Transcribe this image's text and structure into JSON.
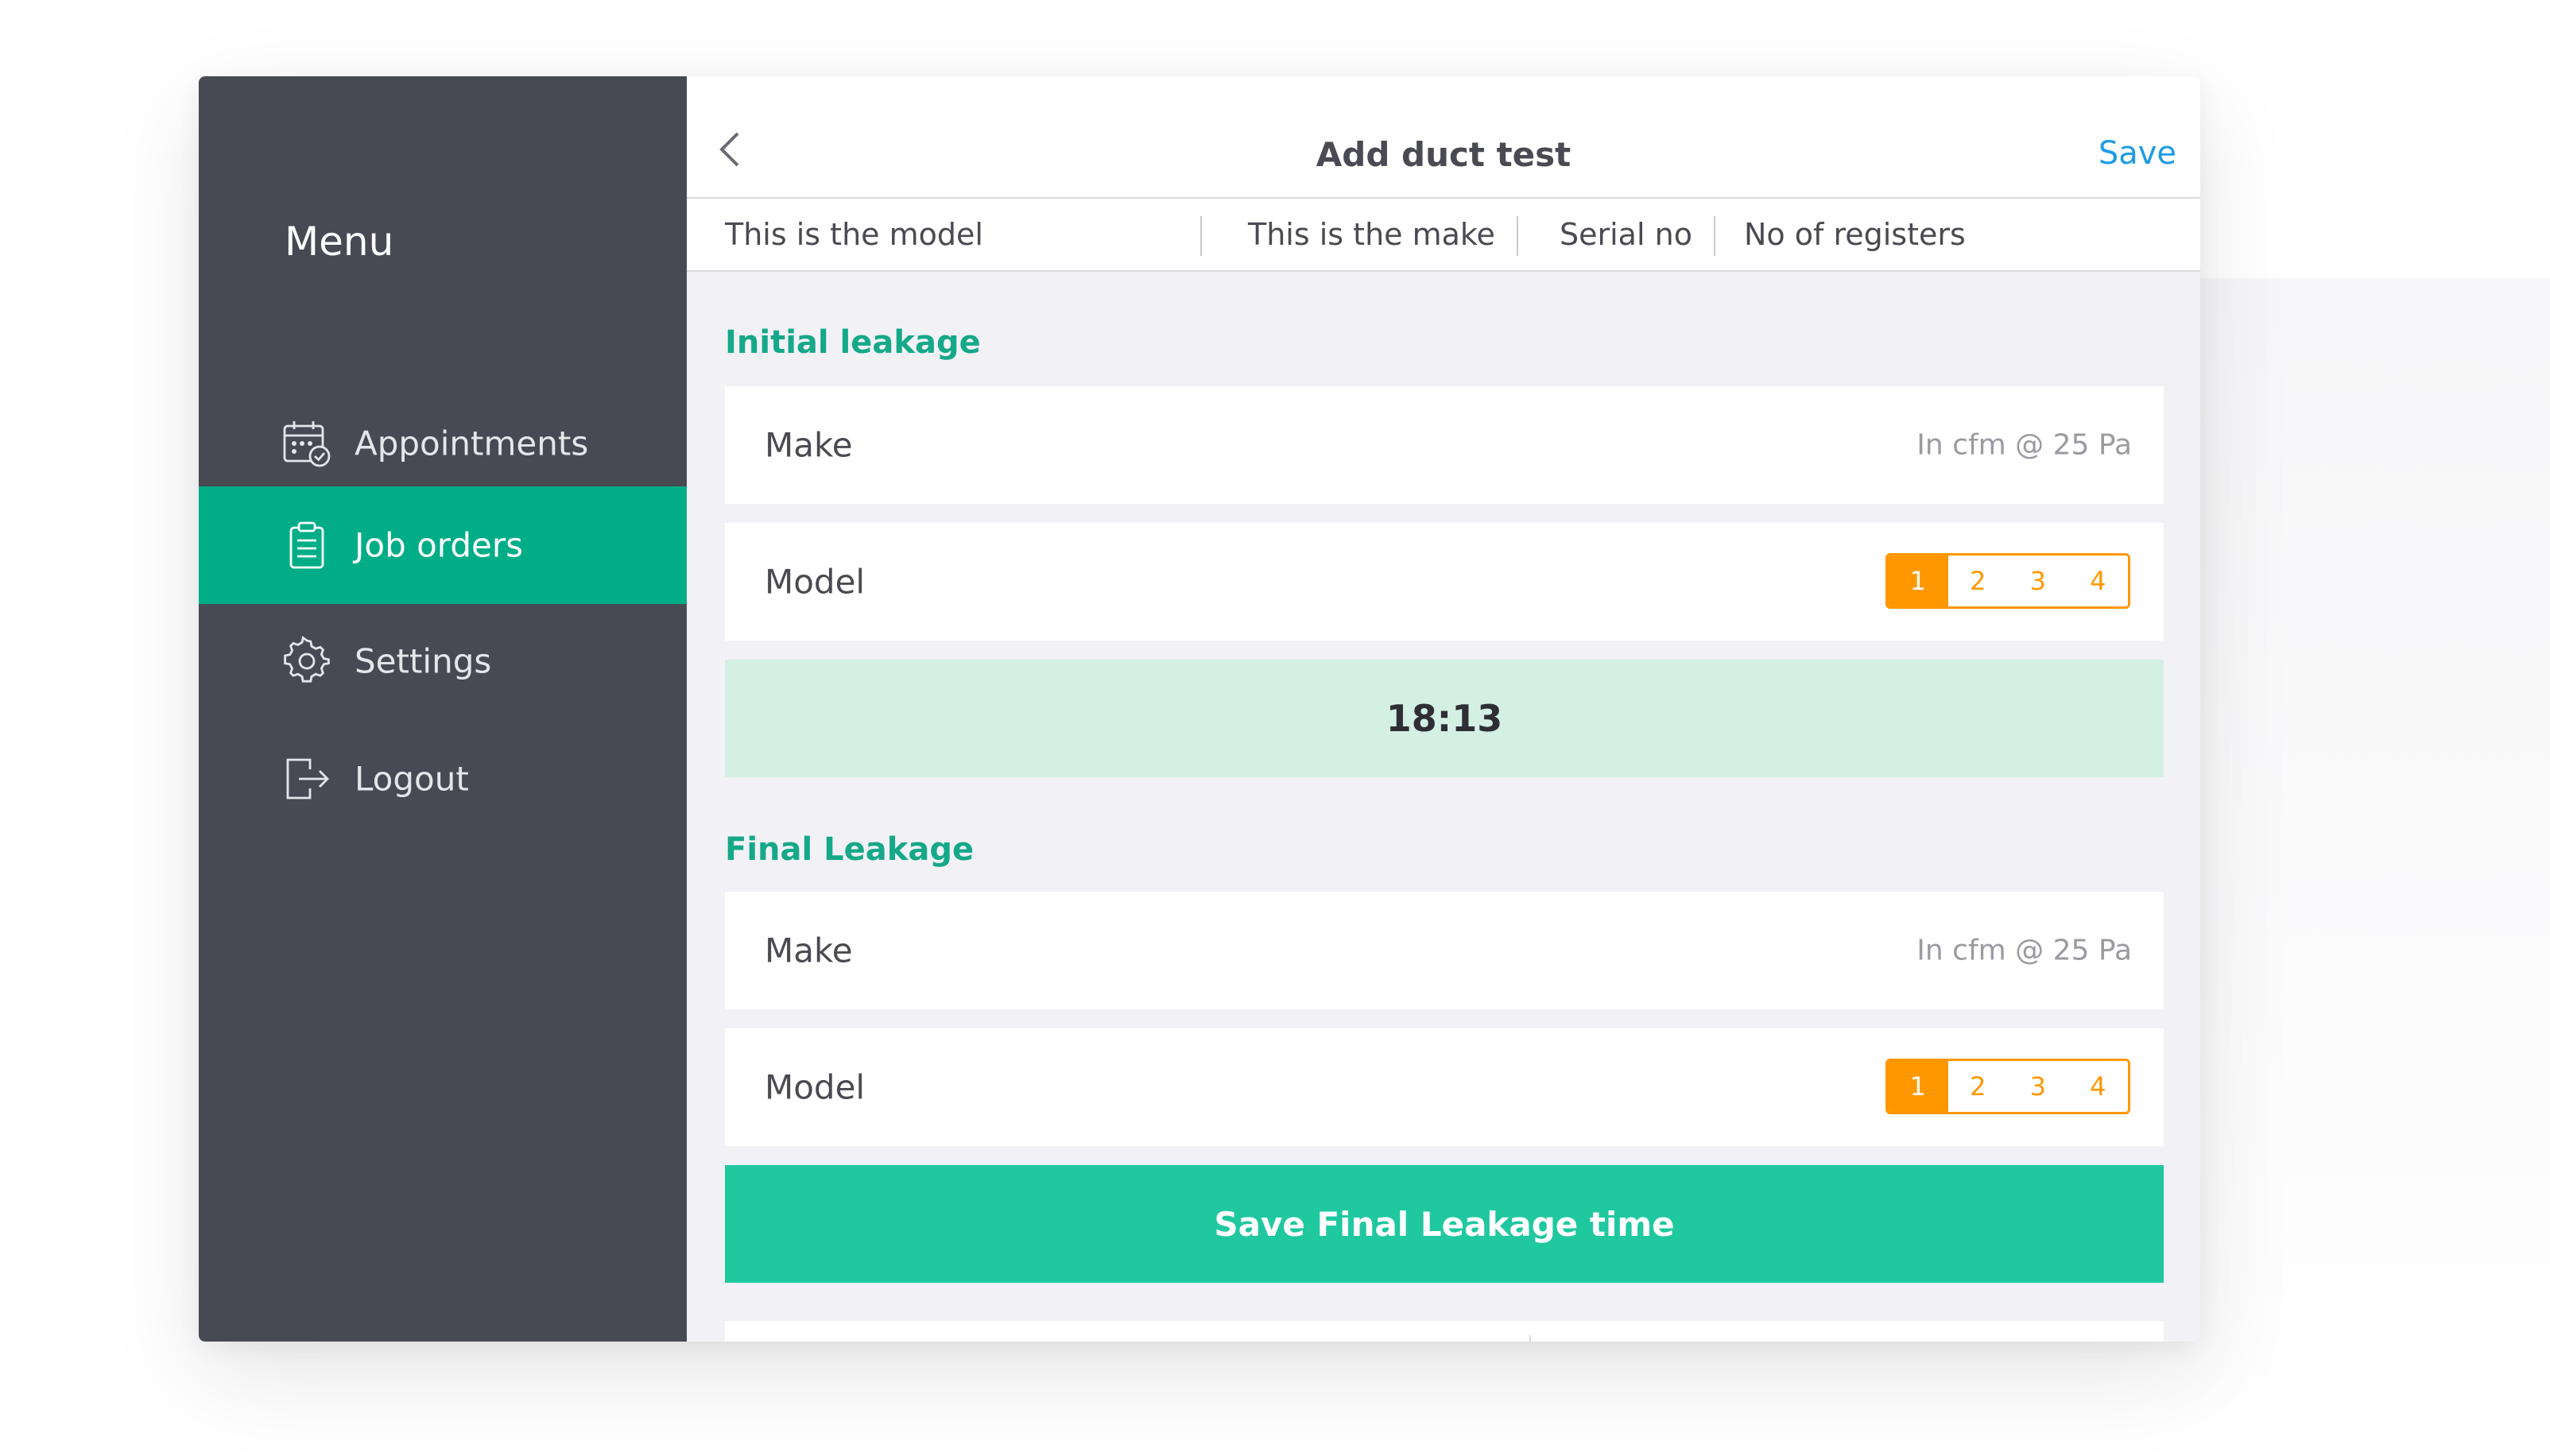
{
  "sidebar": {
    "title": "Menu",
    "items": [
      {
        "label": "Appointments",
        "icon": "calendar-check-icon",
        "active": false
      },
      {
        "label": "Job orders",
        "icon": "clipboard-icon",
        "active": true
      },
      {
        "label": "Settings",
        "icon": "gear-icon",
        "active": false
      },
      {
        "label": "Logout",
        "icon": "logout-icon",
        "active": false
      }
    ]
  },
  "header": {
    "title": "Add duct test",
    "save_label": "Save",
    "back_icon": "chevron-left-icon"
  },
  "info_bar": {
    "model": "This is the model",
    "make": "This is  the make",
    "serial": "Serial no",
    "registers": "No of registers"
  },
  "initial": {
    "title": "Initial leakage",
    "make_label": "Make",
    "make_hint": "In cfm @ 25 Pa",
    "model_label": "Model",
    "options": [
      "1",
      "2",
      "3",
      "4"
    ],
    "selected": "1",
    "timer": "18:13"
  },
  "final": {
    "title": "Final Leakage",
    "make_label": "Make",
    "make_hint": "In cfm @ 25 Pa",
    "model_label": "Model",
    "options": [
      "1",
      "2",
      "3",
      "4"
    ],
    "selected": "1",
    "button_label": "Save Final Leakage time"
  },
  "colors": {
    "sidebar_bg": "#474a53",
    "active_green": "#00ad87",
    "section_green": "#15a889",
    "accent_orange": "#ff9800",
    "link_blue": "#1e9be4",
    "timer_bg": "#d4f0e4",
    "button_bg": "#20c8a0"
  }
}
